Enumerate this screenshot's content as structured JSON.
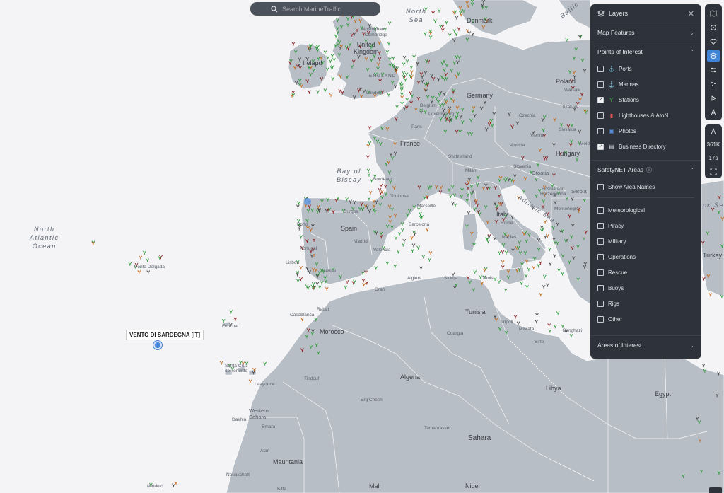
{
  "search": {
    "placeholder": "Search MarineTraffic"
  },
  "vessel": {
    "label": "VENTO DI SARDEGNA [IT]"
  },
  "layers_panel": {
    "title": "Layers",
    "sections": {
      "map_features": "Map Features",
      "points_of_interest": "Points of Interest",
      "safetynet_areas": "SafetyNET Areas",
      "areas_of_interest": "Areas of Interest"
    },
    "poi_items": [
      {
        "label": "Ports",
        "checked": false,
        "icon": "anchor-gold-icon"
      },
      {
        "label": "Marinas",
        "checked": false,
        "icon": "anchor-gray-icon"
      },
      {
        "label": "Stations",
        "checked": true,
        "icon": "station-flag-icon"
      },
      {
        "label": "Lighthouses & AtoN",
        "checked": false,
        "icon": "lighthouse-icon"
      },
      {
        "label": "Photos",
        "checked": false,
        "icon": "photo-icon"
      },
      {
        "label": "Business Directory",
        "checked": true,
        "icon": "document-icon"
      }
    ],
    "safetynet_show_names": "Show Area Names",
    "safetynet_items": [
      "Meteorological",
      "Piracy",
      "Military",
      "Operations",
      "Rescue",
      "Buoys",
      "Rigs",
      "Other"
    ]
  },
  "toolbar": {
    "vessel_count": "361K",
    "refresh": "17s"
  },
  "colors": {
    "land": "#b8bec6",
    "sea": "#f4f4f6",
    "panel": "#2d323b",
    "accent": "#3f84d6",
    "station_green": "#2f9a3a"
  },
  "map_labels": {
    "north_sea": "North\nSea",
    "baltic": "Baltic",
    "bay_of_biscay": "Bay of\nBiscay",
    "north_atlantic": "North\nAtlantic\nOcean",
    "adriatic": "Adriatic Sea",
    "denmark": "Denmark",
    "united_kingdom": "United\nKingdom",
    "england": "ENGLAND",
    "ireland": "Ireland",
    "london": "London",
    "nottingham": "Nottingham",
    "cambridge": "Cambridge",
    "germany": "Germany",
    "poland": "Poland",
    "belgium": "Belgium",
    "luxembourg": "Luxembourg",
    "paris": "Paris",
    "france": "France",
    "czechia": "Czechia",
    "austria": "Austria",
    "slovakia": "Slovakia",
    "hungary": "Hungary",
    "switzerland": "Switzerland",
    "milan": "Milan",
    "slovenia": "Slovenia",
    "croatia": "Croatia",
    "bosnia": "Bosnia and\nHerzegovina",
    "serbia": "Serbia",
    "montenegro": "Montenegro",
    "italy": "Italy",
    "rome": "Rome",
    "naples": "Naples",
    "spain": "Spain",
    "madrid": "Madrid",
    "portugal": "Portugal",
    "lisbon": "Lisbon",
    "bordeaux": "Bordeaux",
    "toulouse": "Toulouse",
    "marseille": "Marseille",
    "barcelona": "Barcelona",
    "valencia": "Valencia",
    "seville": "Seville",
    "porto": "Porto",
    "burgos": "Burgos",
    "morocco": "Morocco",
    "casablanca": "Casablanca",
    "rabat": "Rabat",
    "algiers": "Algiers",
    "oran": "Oran",
    "skikda": "Skikda",
    "algeria": "Algeria",
    "tunis": "Tunis",
    "tunisia": "Tunisia",
    "tripoli": "Tripoli",
    "misrata": "Misrata",
    "sirte": "Sirte",
    "benghazi": "Benghazi",
    "libya": "Libya",
    "egypt": "Egypt",
    "turkey": "Turkey",
    "ouargla": "Ouargla",
    "erg_chech": "Erg Chech",
    "tamanrasset": "Tamanrasset",
    "sahara": "Sahara",
    "western_sahara": "Western\nSahara",
    "dakhla": "Dakhla",
    "mauritania": "Mauritania",
    "nouakchott": "Nouakchott",
    "mali": "Mali",
    "niger": "Niger",
    "santa_cruz": "Santa Cruz\nde Tenerife",
    "ponta_delgada": "Ponta Delgada",
    "funchal": "Funchal",
    "mindelo": "Mindelo",
    "laayoune": "Laayoune",
    "atar": "Atar",
    "kiffa": "Kiffa",
    "smara": "Smara",
    "tindouf": "Tindouf",
    "moldova": "Moldova",
    "vienna": "Vienna",
    "warsaw": "Warsaw",
    "krakow": "Krakow",
    "black_sea": "ck Sea"
  }
}
